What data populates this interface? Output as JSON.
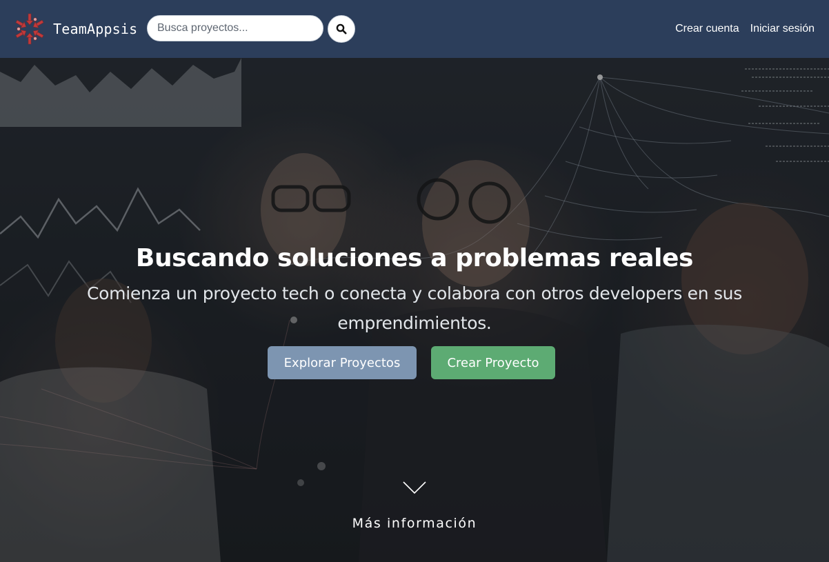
{
  "brand": {
    "name": "TeamAppsis",
    "logo_icon": "team-arrows-logo-icon"
  },
  "search": {
    "placeholder": "Busca proyectos...",
    "value": "",
    "icon": "search-icon"
  },
  "nav": {
    "links": [
      {
        "label": "Crear cuenta"
      },
      {
        "label": "Iniciar sesión"
      }
    ]
  },
  "hero": {
    "title": "Buscando soluciones a problemas reales",
    "subtitle": "Comienza un proyecto tech o conecta y colabora con otros developers en sus emprendimientos.",
    "buttons": {
      "explore": "Explorar Proyectos",
      "create": "Crear Proyecto"
    },
    "more_info": "Más información",
    "scroll_icon": "chevron-down-icon"
  },
  "colors": {
    "navbar": "#2c3e5b",
    "explore_button": "#7d95b1",
    "create_button": "#5dab73",
    "logo_accent": "#c0393b"
  }
}
